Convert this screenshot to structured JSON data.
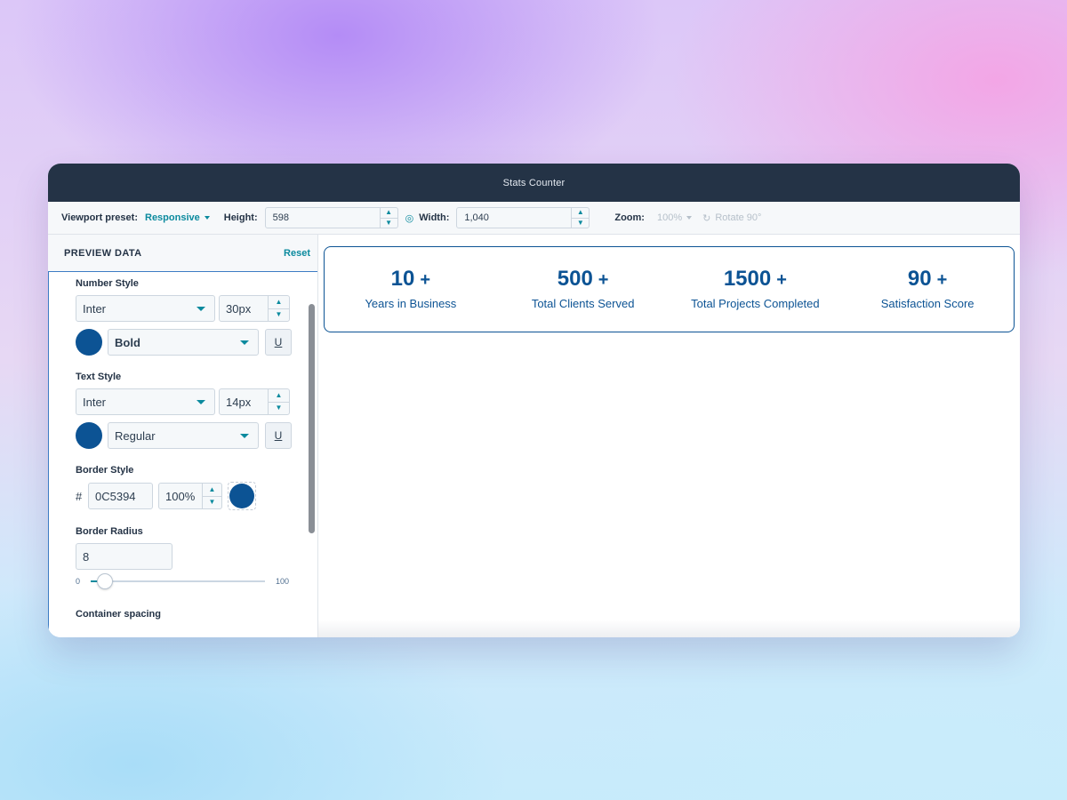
{
  "window": {
    "title": "Stats Counter"
  },
  "toolbar": {
    "viewport_label": "Viewport preset:",
    "viewport_value": "Responsive",
    "height_label": "Height:",
    "height_value": "598",
    "width_label": "Width:",
    "width_value": "1,040",
    "zoom_label": "Zoom:",
    "zoom_value": "100%",
    "rotate_label": "Rotate 90°"
  },
  "sidebar": {
    "title": "PREVIEW DATA",
    "reset_label": "Reset",
    "number_style": {
      "label": "Number Style",
      "font": "Inter",
      "size": "30px",
      "color": "#0C5394",
      "weight": "Bold",
      "underline_label": "U"
    },
    "text_style": {
      "label": "Text Style",
      "font": "Inter",
      "size": "14px",
      "color": "#0C5394",
      "weight": "Regular",
      "underline_label": "U"
    },
    "border_style": {
      "label": "Border Style",
      "hash": "#",
      "hex": "0C5394",
      "opacity": "100%",
      "color": "#0C5394"
    },
    "border_radius": {
      "label": "Border Radius",
      "value": "8",
      "min": "0",
      "max": "100",
      "slider_fraction": 0.08
    },
    "container_spacing": {
      "label": "Container spacing"
    }
  },
  "stats": [
    {
      "number": "10",
      "plus": "+",
      "text": "Years in Business"
    },
    {
      "number": "500",
      "plus": "+",
      "text": "Total Clients Served"
    },
    {
      "number": "1500",
      "plus": "+",
      "text": "Total Projects Completed"
    },
    {
      "number": "90",
      "plus": "+",
      "text": "Satisfaction Score"
    }
  ],
  "colors": {
    "accent": "#0B8A9E",
    "brand": "#0C5394",
    "titlebar": "#243346"
  }
}
